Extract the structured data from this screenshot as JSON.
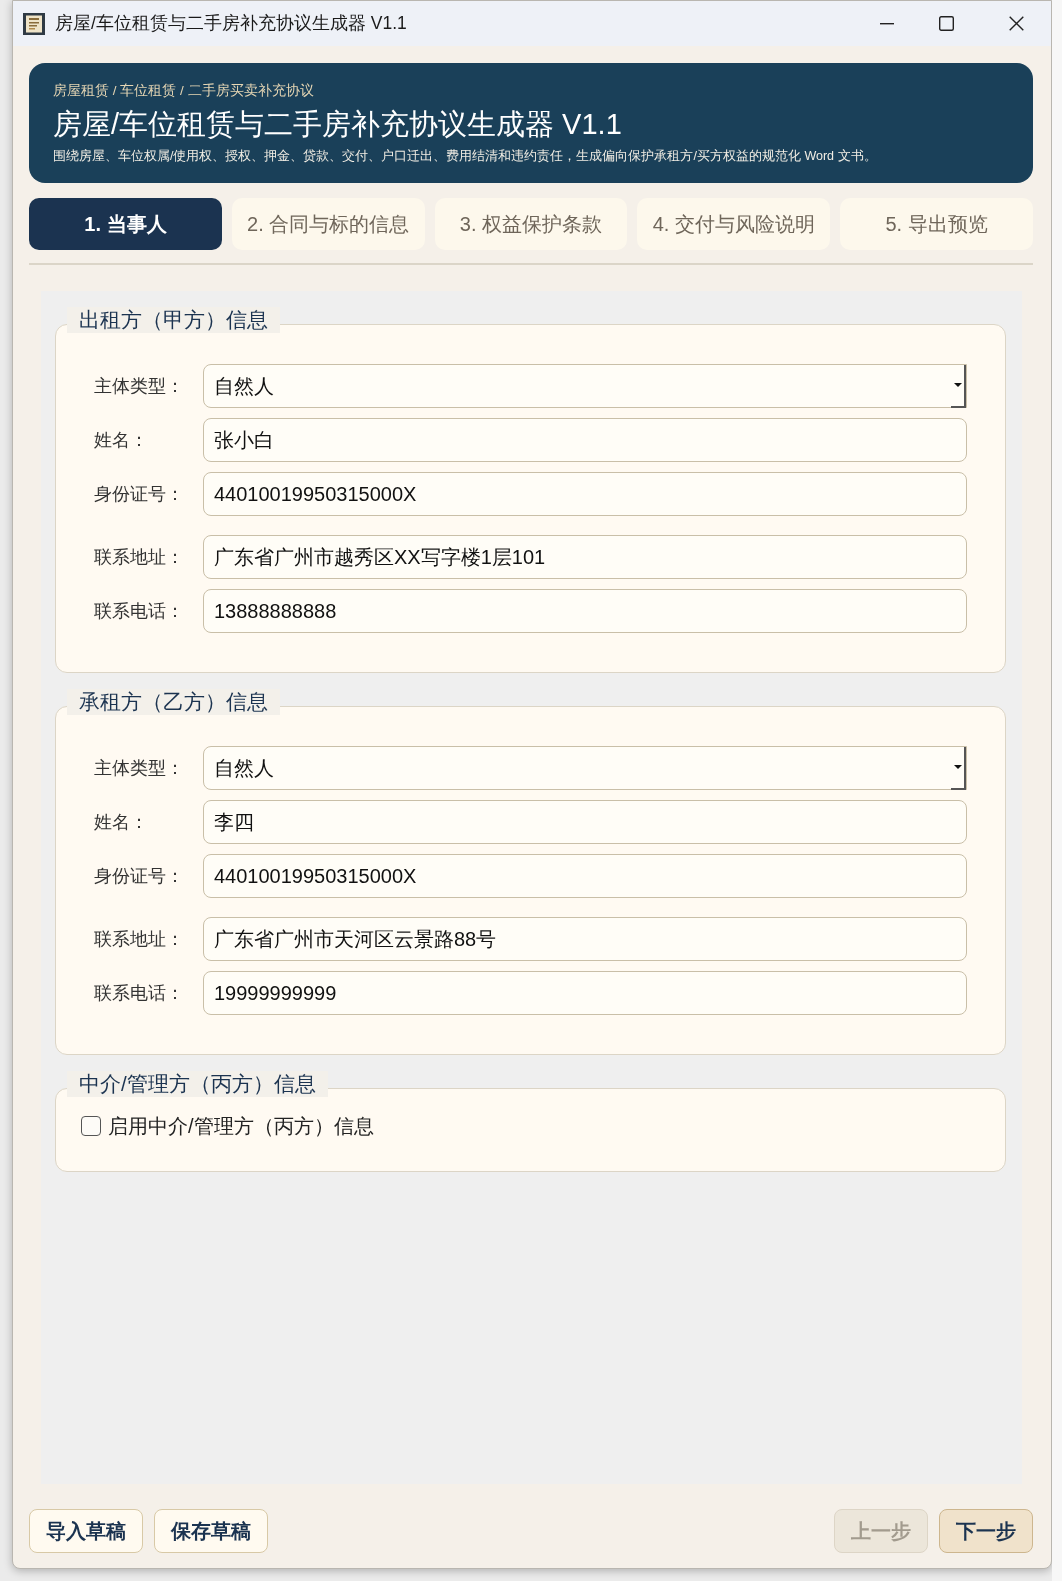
{
  "window": {
    "title": "房屋/车位租赁与二手房补充协议生成器 V1.1"
  },
  "header": {
    "breadcrumb": "房屋租赁 / 车位租赁 / 二手房买卖补充协议",
    "title": "房屋/车位租赁与二手房补充协议生成器 V1.1",
    "subtitle": "围绕房屋、车位权属/使用权、授权、押金、贷款、交付、户口迁出、费用结清和违约责任，生成偏向保护承租方/买方权益的规范化 Word 文书。"
  },
  "tabs": [
    {
      "label": "1. 当事人",
      "selected": true
    },
    {
      "label": "2. 合同与标的信息",
      "selected": false
    },
    {
      "label": "3. 权益保护条款",
      "selected": false
    },
    {
      "label": "4. 交付与风险说明",
      "selected": false
    },
    {
      "label": "5. 导出预览",
      "selected": false
    }
  ],
  "groups": [
    {
      "title": "出租方（甲方）信息",
      "fields": [
        {
          "kind": "select",
          "label": "主体类型：",
          "value": "自然人"
        },
        {
          "kind": "text",
          "label": "姓名：",
          "value": "张小白"
        },
        {
          "kind": "text",
          "label": "身份证号：",
          "value": "44010019950315000X"
        },
        {
          "kind": "text",
          "label": "联系地址：",
          "value": "广东省广州市越秀区XX写字楼1层101"
        },
        {
          "kind": "text",
          "label": "联系电话：",
          "value": "13888888888"
        }
      ]
    },
    {
      "title": "承租方（乙方）信息",
      "fields": [
        {
          "kind": "select",
          "label": "主体类型：",
          "value": "自然人"
        },
        {
          "kind": "text",
          "label": "姓名：",
          "value": "李四"
        },
        {
          "kind": "text",
          "label": "身份证号：",
          "value": "44010019950315000X"
        },
        {
          "kind": "text",
          "label": "联系地址：",
          "value": "广东省广州市天河区云景路88号"
        },
        {
          "kind": "text",
          "label": "联系电话：",
          "value": "19999999999"
        }
      ]
    },
    {
      "title": "中介/管理方（丙方）信息",
      "fields": [
        {
          "kind": "checkbox",
          "label": "启用中介/管理方（丙方）信息",
          "checked": false
        }
      ]
    }
  ],
  "footer": {
    "left_buttons": [
      {
        "label": "导入草稿",
        "kind": "plain",
        "disabled": false
      },
      {
        "label": "保存草稿",
        "kind": "plain",
        "disabled": false
      }
    ],
    "right_buttons": [
      {
        "label": "上一步",
        "kind": "plain",
        "disabled": true
      },
      {
        "label": "下一步",
        "kind": "primary",
        "disabled": false
      }
    ]
  }
}
